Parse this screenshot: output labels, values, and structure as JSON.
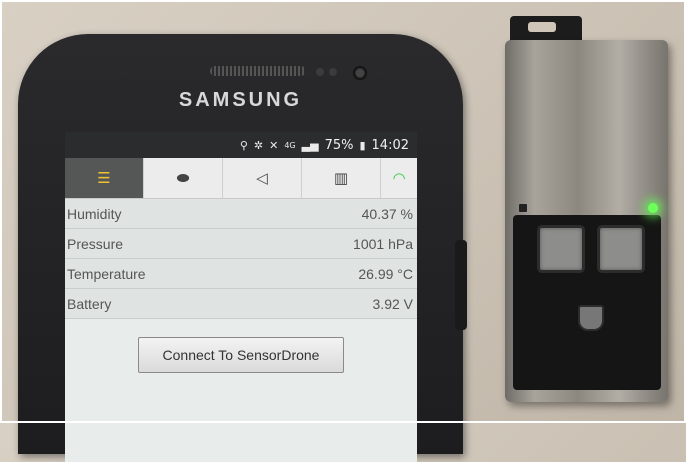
{
  "phone": {
    "brand": "SAMSUNG"
  },
  "status_bar": {
    "network": "4G",
    "battery": "75%",
    "time": "14:02"
  },
  "tabs": [
    {
      "icon": "menu-icon",
      "active": true
    },
    {
      "icon": "chat-icon",
      "active": false
    },
    {
      "icon": "megaphone-icon",
      "active": false
    },
    {
      "icon": "map-icon",
      "active": false
    },
    {
      "icon": "wifi-icon",
      "active": false
    }
  ],
  "readings": [
    {
      "label": "Humidity",
      "value": "40.37 %"
    },
    {
      "label": "Pressure",
      "value": "1001 hPa"
    },
    {
      "label": "Temperature",
      "value": "26.99 °C"
    },
    {
      "label": "Battery",
      "value": "3.92 V"
    }
  ],
  "connect_button": {
    "label": "Connect To SensorDrone"
  },
  "colors": {
    "active_tab_bg": "#555656",
    "active_tab_icon": "#f1c232",
    "wifi_icon": "#2ecc40",
    "led": "#6dff5a"
  }
}
